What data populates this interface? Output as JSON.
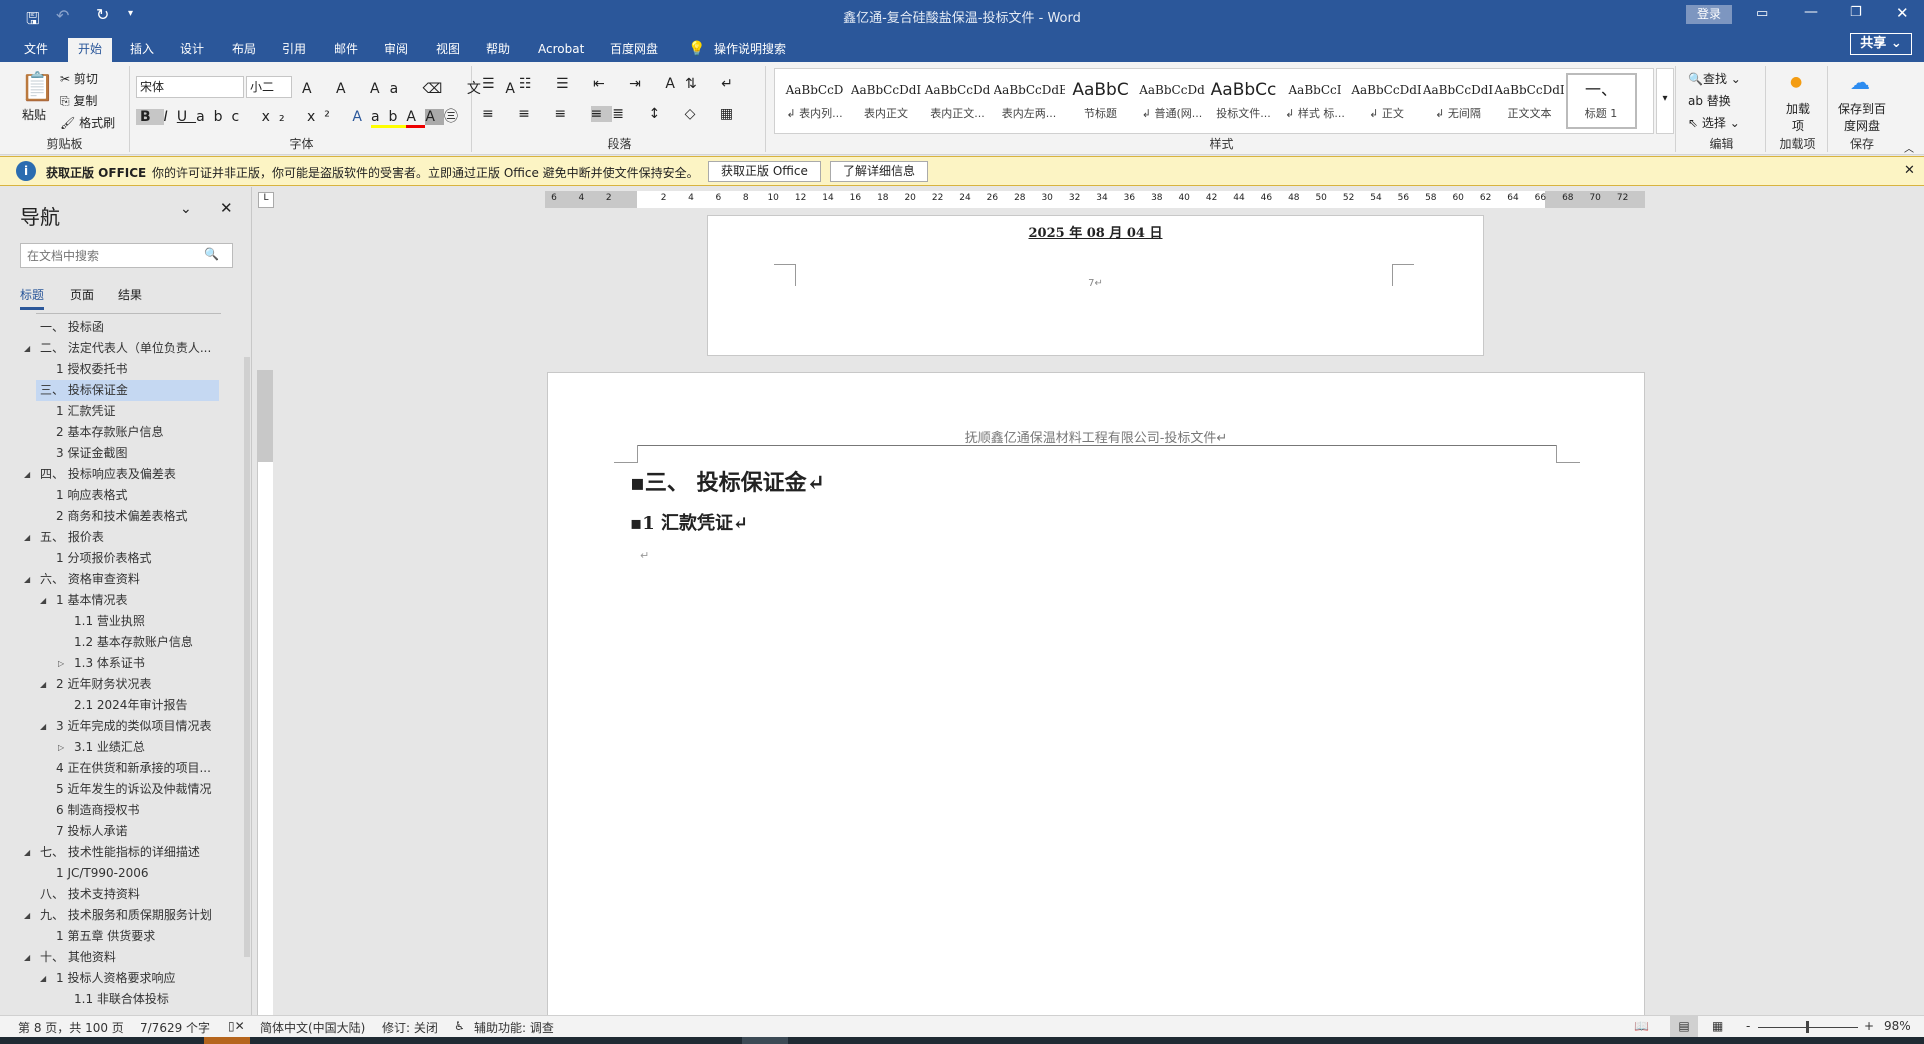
{
  "titlebar": {
    "title": "鑫亿通-复合硅酸盐保温-投标文件  -  Word",
    "login": "登录",
    "share": "共享"
  },
  "tabs": [
    "文件",
    "开始",
    "插入",
    "设计",
    "布局",
    "引用",
    "邮件",
    "审阅",
    "视图",
    "帮助",
    "Acrobat",
    "百度网盘",
    "操作说明搜索"
  ],
  "ribbon": {
    "clipboard": {
      "label": "剪贴板",
      "paste": "粘贴",
      "cut": "剪切",
      "copy": "复制",
      "format_painter": "格式刷"
    },
    "font": {
      "label": "字体",
      "font_name": "宋体",
      "font_size": "小二"
    },
    "paragraph": {
      "label": "段落"
    },
    "styles": {
      "label": "样式",
      "items": [
        {
          "preview": "AaBbCcD",
          "name": "↲ 表内列..."
        },
        {
          "preview": "AaBbCcDdI",
          "name": "表内正文"
        },
        {
          "preview": "AaBbCcDd",
          "name": "表内正文..."
        },
        {
          "preview": "AaBbCcDdEe",
          "name": "表内左两..."
        },
        {
          "preview": "AaBbC",
          "name": "节标题"
        },
        {
          "preview": "AaBbCcDd",
          "name": "↲ 普通(网..."
        },
        {
          "preview": "AaBbCc",
          "name": "投标文件..."
        },
        {
          "preview": "AaBbCcI",
          "name": "↲ 样式 标..."
        },
        {
          "preview": "AaBbCcDdI",
          "name": "↲ 正文"
        },
        {
          "preview": "AaBbCcDdI",
          "name": "↲ 无间隔"
        },
        {
          "preview": "AaBbCcDdI",
          "name": "正文文本"
        },
        {
          "preview": "一、",
          "name": "标题 1"
        }
      ]
    },
    "editing": {
      "label": "编辑",
      "find": "查找",
      "replace": "替换",
      "select": "选择"
    },
    "addins": {
      "label": "加载项",
      "button": "加载项"
    },
    "save": {
      "label": "保存",
      "button": "保存到百度网盘"
    }
  },
  "infobar": {
    "title": "获取正版 OFFICE",
    "message": "你的许可证并非正版，你可能是盗版软件的受害者。立即通过正版 Office 避免中断并使文件保持安全。",
    "btn_get": "获取正版 Office",
    "btn_learn": "了解详细信息"
  },
  "nav": {
    "title": "导航",
    "search_placeholder": "在文档中搜索",
    "tabs": [
      "标题",
      "页面",
      "结果"
    ],
    "items": [
      {
        "text": "一、 投标函",
        "level": 0,
        "tri": ""
      },
      {
        "text": "二、 法定代表人（单位负责人...",
        "level": 0,
        "tri": "▲"
      },
      {
        "text": "1 授权委托书",
        "level": 1,
        "tri": ""
      },
      {
        "text": "三、 投标保证金",
        "level": 0,
        "tri": "▲",
        "selected": true
      },
      {
        "text": "1 汇款凭证",
        "level": 1,
        "tri": ""
      },
      {
        "text": "2 基本存款账户信息",
        "level": 1,
        "tri": ""
      },
      {
        "text": "3 保证金截图",
        "level": 1,
        "tri": ""
      },
      {
        "text": "四、 投标响应表及偏差表",
        "level": 0,
        "tri": "▲"
      },
      {
        "text": "1 响应表格式",
        "level": 1,
        "tri": ""
      },
      {
        "text": "2 商务和技术偏差表格式",
        "level": 1,
        "tri": ""
      },
      {
        "text": "五、 报价表",
        "level": 0,
        "tri": "▲"
      },
      {
        "text": "1 分项报价表格式",
        "level": 1,
        "tri": ""
      },
      {
        "text": "六、 资格审查资料",
        "level": 0,
        "tri": "▲"
      },
      {
        "text": "1 基本情况表",
        "level": 1,
        "tri": "▲"
      },
      {
        "text": "1.1 营业执照",
        "level": 2,
        "tri": ""
      },
      {
        "text": "1.2 基本存款账户信息",
        "level": 2,
        "tri": ""
      },
      {
        "text": "1.3 体系证书",
        "level": 2,
        "tri": "▷"
      },
      {
        "text": "2 近年财务状况表",
        "level": 1,
        "tri": "▲"
      },
      {
        "text": "2.1 2024年审计报告",
        "level": 2,
        "tri": ""
      },
      {
        "text": "3 近年完成的类似项目情况表",
        "level": 1,
        "tri": "▲"
      },
      {
        "text": "3.1 业绩汇总",
        "level": 2,
        "tri": "▷"
      },
      {
        "text": "4 正在供货和新承接的项目...",
        "level": 1,
        "tri": ""
      },
      {
        "text": "5 近年发生的诉讼及仲裁情况",
        "level": 1,
        "tri": ""
      },
      {
        "text": "6 制造商授权书",
        "level": 1,
        "tri": ""
      },
      {
        "text": "7 投标人承诺",
        "level": 1,
        "tri": ""
      },
      {
        "text": "七、 技术性能指标的详细描述",
        "level": 0,
        "tri": "▲"
      },
      {
        "text": "1 JC/T990-2006",
        "level": 1,
        "tri": ""
      },
      {
        "text": "八、 技术支持资料",
        "level": 0,
        "tri": ""
      },
      {
        "text": "九、 技术服务和质保期服务计划",
        "level": 0,
        "tri": "▲"
      },
      {
        "text": "1 第五章  供货要求",
        "level": 1,
        "tri": ""
      },
      {
        "text": "十、 其他资料",
        "level": 0,
        "tri": "▲"
      },
      {
        "text": "1 投标人资格要求响应",
        "level": 1,
        "tri": "▲"
      },
      {
        "text": "1.1 非联合体投标",
        "level": 2,
        "tri": ""
      }
    ]
  },
  "ruler": {
    "ticks": [
      "6",
      "4",
      "2",
      "",
      "2",
      "4",
      "6",
      "8",
      "10",
      "12",
      "14",
      "16",
      "18",
      "20",
      "22",
      "24",
      "26",
      "28",
      "30",
      "32",
      "34",
      "36",
      "38",
      "40",
      "42",
      "44",
      "46",
      "48",
      "50",
      "52",
      "54",
      "56",
      "58",
      "60",
      "62",
      "64",
      "66",
      "68",
      "70",
      "72"
    ]
  },
  "document": {
    "date": "2025 年 08 月 04 日",
    "page_number": "7↵",
    "header": "抚顺鑫亿通保温材料工程有限公司-投标文件↵",
    "heading1": "三、 投标保证金↵",
    "heading2": "1   汇款凭证↵",
    "para_mark": "↵"
  },
  "status": {
    "page": "第 8 页，共 100 页",
    "words": "7/7629 个字",
    "language": "简体中文(中国大陆)",
    "track": "修订: 关闭",
    "accessibility": "辅助功能: 调查",
    "zoom": "98%",
    "zoom_value": 98
  }
}
